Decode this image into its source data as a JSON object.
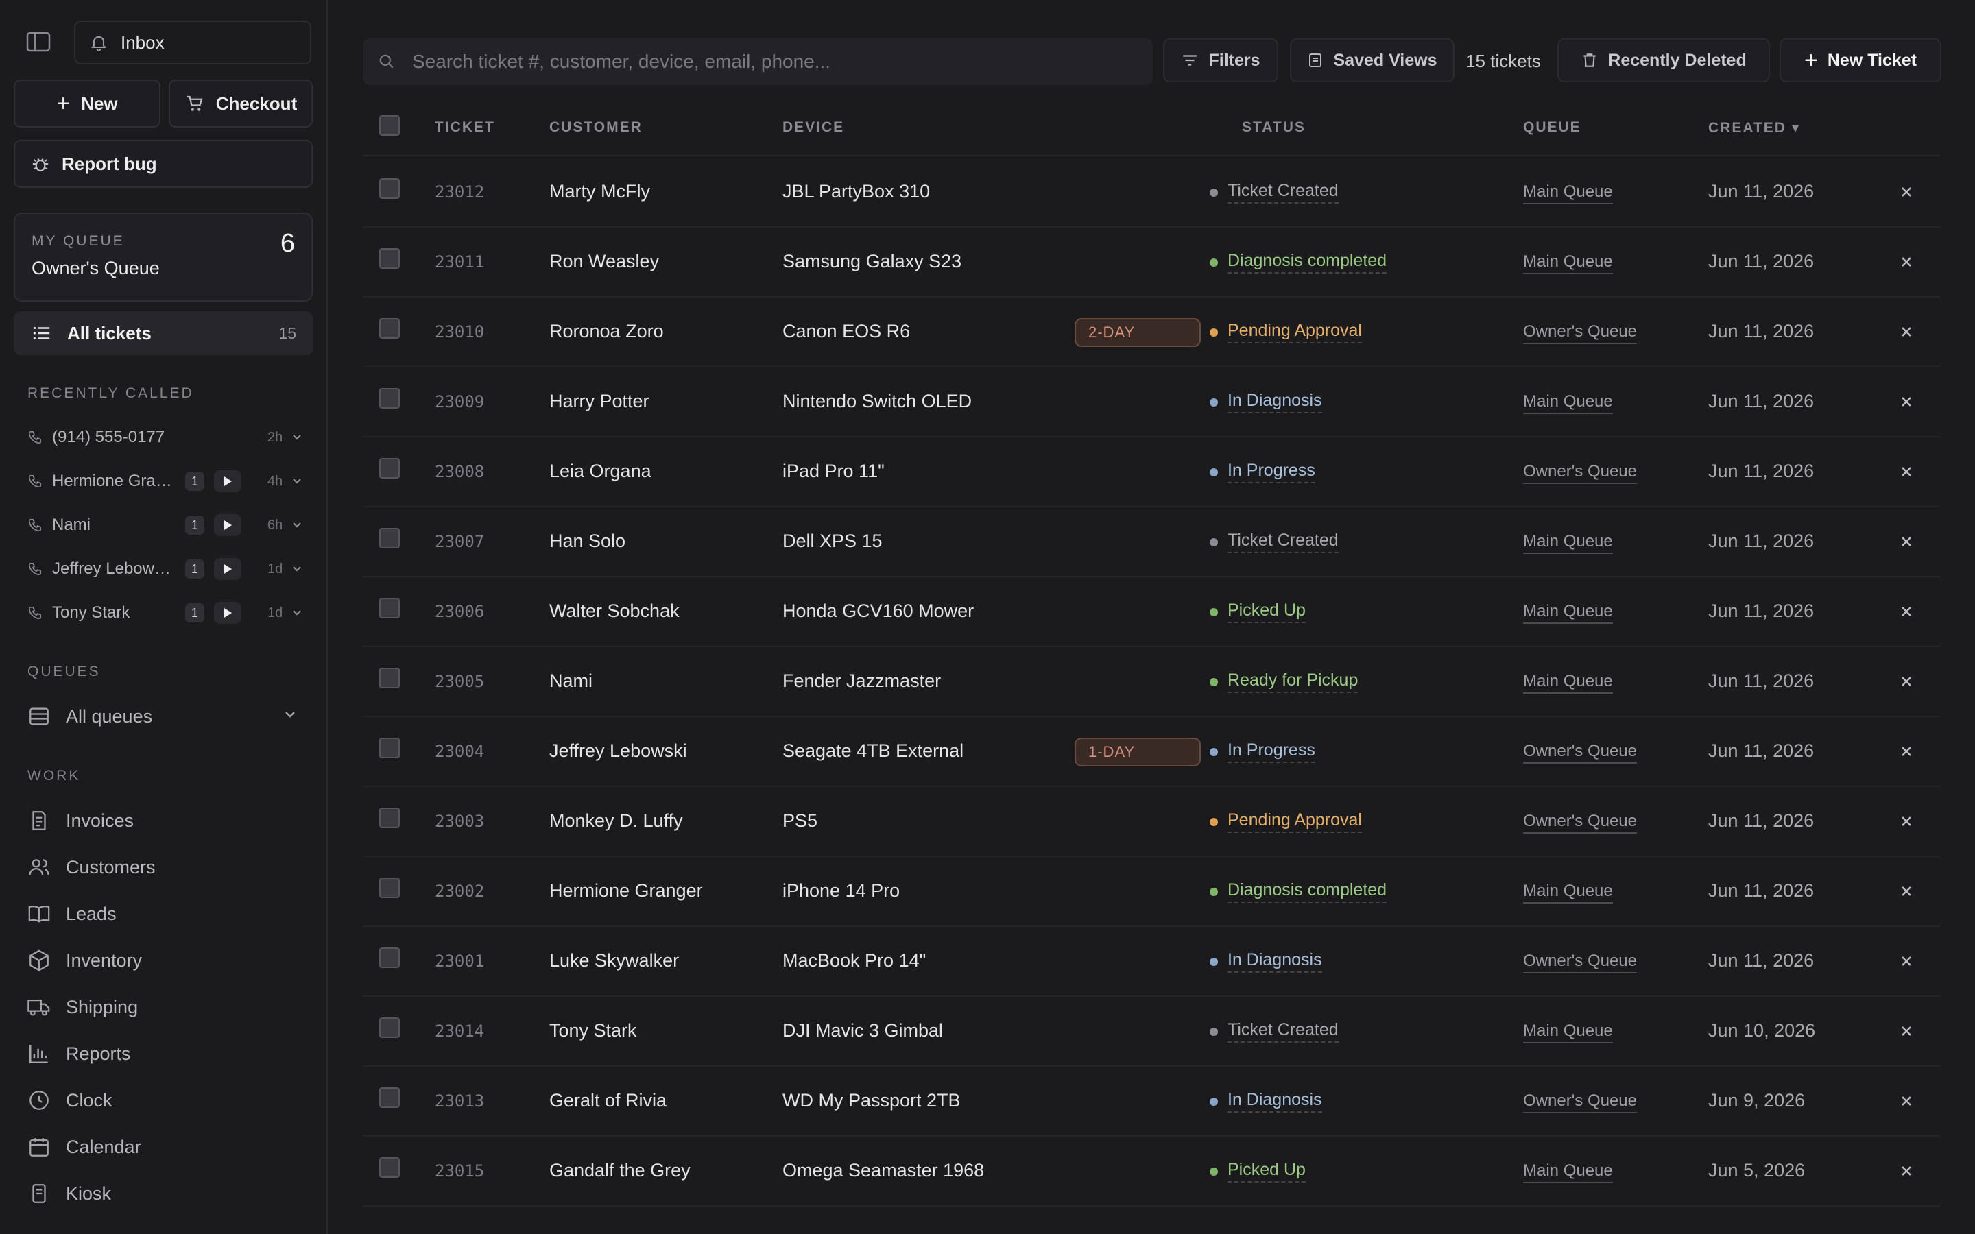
{
  "sidebar": {
    "inbox_label": "Inbox",
    "new_label": "New",
    "checkout_label": "Checkout",
    "report_bug_label": "Report bug",
    "my_queue": {
      "label": "MY QUEUE",
      "name": "Owner's Queue",
      "count": "6"
    },
    "all_tickets": {
      "label": "All tickets",
      "count": "15"
    },
    "recently_called_label": "RECENTLY CALLED",
    "recently_called": [
      {
        "name": "(914) 555-0177",
        "badge": "",
        "ago": "2h"
      },
      {
        "name": "Hermione Granger",
        "badge": "1",
        "ago": "4h"
      },
      {
        "name": "Nami",
        "badge": "1",
        "ago": "6h"
      },
      {
        "name": "Jeffrey Lebowski",
        "badge": "1",
        "ago": "1d"
      },
      {
        "name": "Tony Stark",
        "badge": "1",
        "ago": "1d"
      }
    ],
    "queues_label": "QUEUES",
    "all_queues_label": "All queues",
    "work_label": "WORK",
    "work_items": [
      {
        "label": "Invoices",
        "icon": "invoice-icon"
      },
      {
        "label": "Customers",
        "icon": "users-icon"
      },
      {
        "label": "Leads",
        "icon": "book-icon"
      },
      {
        "label": "Inventory",
        "icon": "box-icon"
      },
      {
        "label": "Shipping",
        "icon": "truck-icon"
      },
      {
        "label": "Reports",
        "icon": "bar-chart-icon"
      },
      {
        "label": "Clock",
        "icon": "clock-icon"
      },
      {
        "label": "Calendar",
        "icon": "calendar-icon"
      },
      {
        "label": "Kiosk",
        "icon": "kiosk-icon"
      }
    ]
  },
  "toolbar": {
    "search_placeholder": "Search ticket #, customer, device, email, phone...",
    "filters_label": "Filters",
    "saved_views_label": "Saved Views",
    "ticket_count": "15 tickets",
    "recently_deleted_label": "Recently Deleted",
    "new_ticket_label": "New Ticket"
  },
  "table": {
    "columns": {
      "ticket": "TICKET",
      "customer": "CUSTOMER",
      "device": "DEVICE",
      "status": "STATUS",
      "queue": "QUEUE",
      "created": "CREATED ▾"
    },
    "status_colors": {
      "Ticket Created": {
        "dot": "#8b8b93",
        "text": "#a9a9b0"
      },
      "Diagnosis completed": {
        "dot": "#7fb46a",
        "text": "#9ccb86"
      },
      "Pending Approval": {
        "dot": "#e0a052",
        "text": "#e6b06a"
      },
      "In Diagnosis": {
        "dot": "#8aa6c8",
        "text": "#a8c0dc"
      },
      "In Progress": {
        "dot": "#8aa6c8",
        "text": "#a8c0dc"
      },
      "Picked Up": {
        "dot": "#7fb46a",
        "text": "#9ccb86"
      },
      "Ready for Pickup": {
        "dot": "#7fb46a",
        "text": "#9ccb86"
      }
    },
    "rows": [
      {
        "id": "23012",
        "customer": "Marty McFly",
        "device": "JBL PartyBox 310",
        "tag": "",
        "status": "Ticket Created",
        "queue": "Main Queue",
        "created": "Jun 11, 2026"
      },
      {
        "id": "23011",
        "customer": "Ron Weasley",
        "device": "Samsung Galaxy S23",
        "tag": "",
        "status": "Diagnosis completed",
        "queue": "Main Queue",
        "created": "Jun 11, 2026"
      },
      {
        "id": "23010",
        "customer": "Roronoa Zoro",
        "device": "Canon EOS R6",
        "tag": "2-DAY",
        "status": "Pending Approval",
        "queue": "Owner's Queue",
        "created": "Jun 11, 2026"
      },
      {
        "id": "23009",
        "customer": "Harry Potter",
        "device": "Nintendo Switch OLED",
        "tag": "",
        "status": "In Diagnosis",
        "queue": "Main Queue",
        "created": "Jun 11, 2026"
      },
      {
        "id": "23008",
        "customer": "Leia Organa",
        "device": "iPad Pro 11\"",
        "tag": "",
        "status": "In Progress",
        "queue": "Owner's Queue",
        "created": "Jun 11, 2026"
      },
      {
        "id": "23007",
        "customer": "Han Solo",
        "device": "Dell XPS 15",
        "tag": "",
        "status": "Ticket Created",
        "queue": "Main Queue",
        "created": "Jun 11, 2026"
      },
      {
        "id": "23006",
        "customer": "Walter Sobchak",
        "device": "Honda GCV160 Mower",
        "tag": "",
        "status": "Picked Up",
        "queue": "Main Queue",
        "created": "Jun 11, 2026"
      },
      {
        "id": "23005",
        "customer": "Nami",
        "device": "Fender Jazzmaster",
        "tag": "",
        "status": "Ready for Pickup",
        "queue": "Main Queue",
        "created": "Jun 11, 2026"
      },
      {
        "id": "23004",
        "customer": "Jeffrey Lebowski",
        "device": "Seagate 4TB External",
        "tag": "1-DAY",
        "status": "In Progress",
        "queue": "Owner's Queue",
        "created": "Jun 11, 2026"
      },
      {
        "id": "23003",
        "customer": "Monkey D. Luffy",
        "device": "PS5",
        "tag": "",
        "status": "Pending Approval",
        "queue": "Owner's Queue",
        "created": "Jun 11, 2026"
      },
      {
        "id": "23002",
        "customer": "Hermione Granger",
        "device": "iPhone 14 Pro",
        "tag": "",
        "status": "Diagnosis completed",
        "queue": "Main Queue",
        "created": "Jun 11, 2026"
      },
      {
        "id": "23001",
        "customer": "Luke Skywalker",
        "device": "MacBook Pro 14\"",
        "tag": "",
        "status": "In Diagnosis",
        "queue": "Owner's Queue",
        "created": "Jun 11, 2026"
      },
      {
        "id": "23014",
        "customer": "Tony Stark",
        "device": "DJI Mavic 3 Gimbal",
        "tag": "",
        "status": "Ticket Created",
        "queue": "Main Queue",
        "created": "Jun 10, 2026"
      },
      {
        "id": "23013",
        "customer": "Geralt of Rivia",
        "device": "WD My Passport 2TB",
        "tag": "",
        "status": "In Diagnosis",
        "queue": "Owner's Queue",
        "created": "Jun 9, 2026"
      },
      {
        "id": "23015",
        "customer": "Gandalf the Grey",
        "device": "Omega Seamaster 1968",
        "tag": "",
        "status": "Picked Up",
        "queue": "Main Queue",
        "created": "Jun 5, 2026"
      }
    ]
  }
}
